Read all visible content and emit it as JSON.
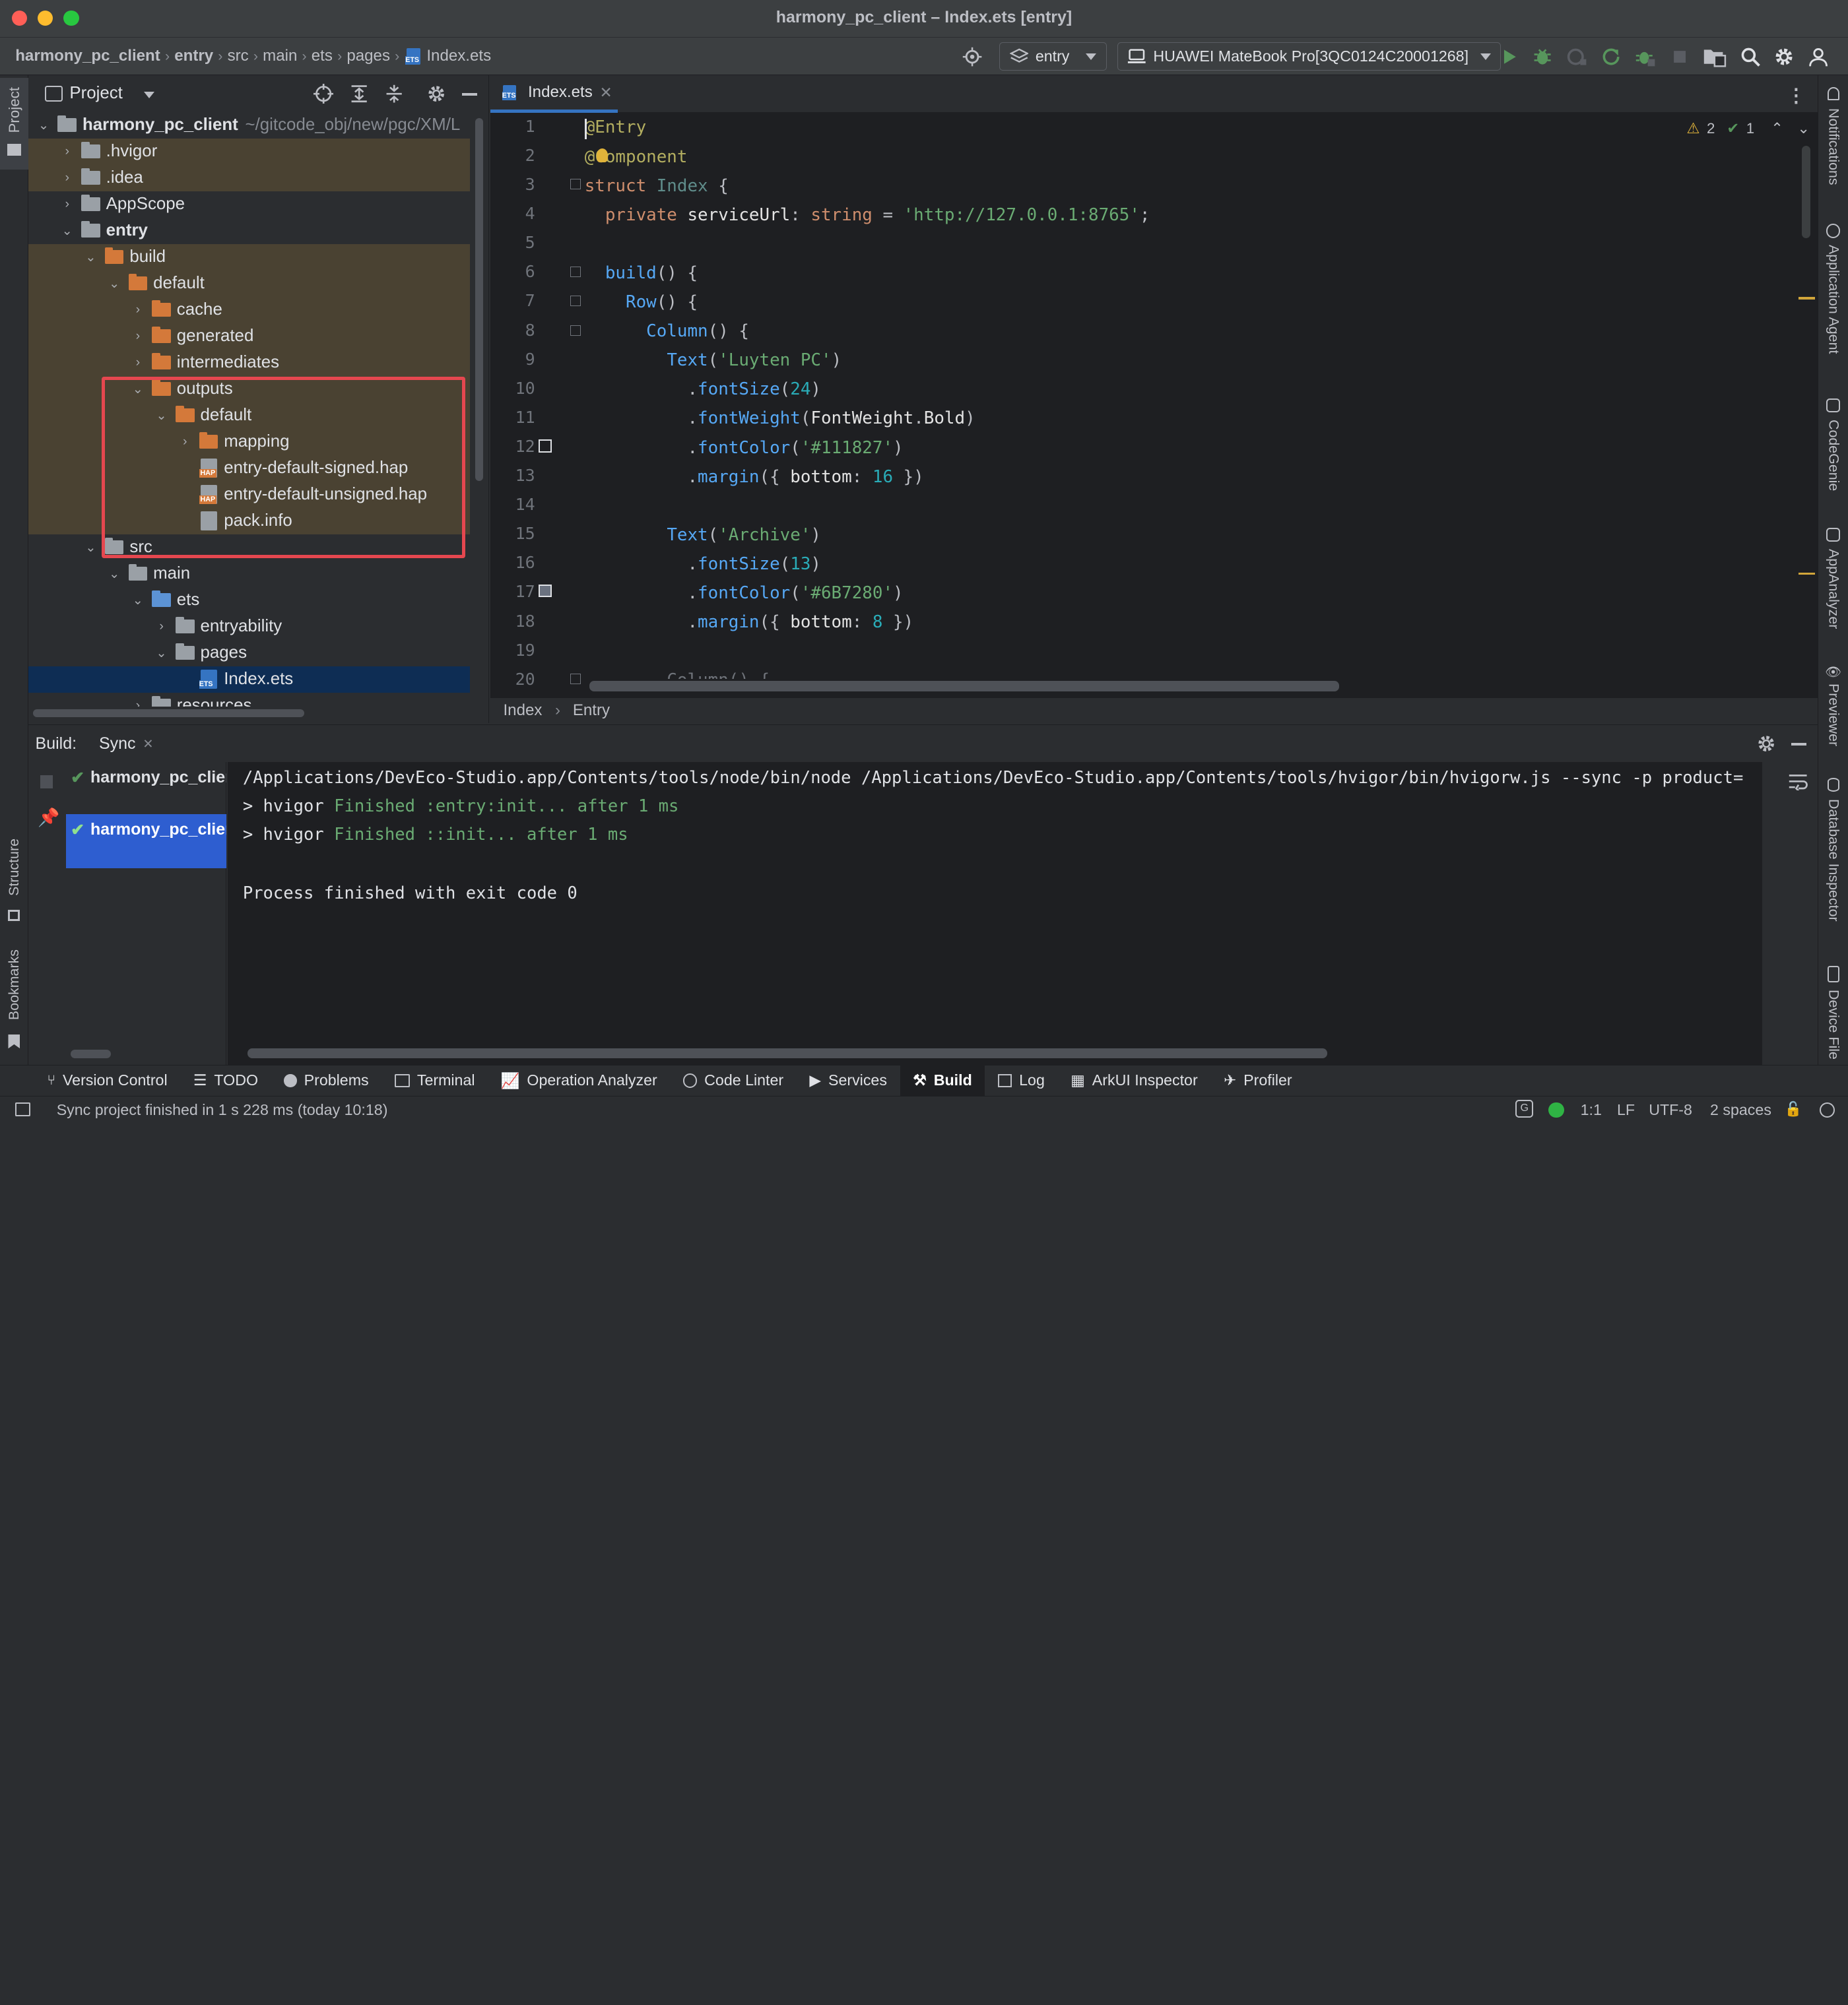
{
  "window": {
    "title": "harmony_pc_client – Index.ets [entry]"
  },
  "breadcrumbs": [
    "harmony_pc_client",
    "entry",
    "src",
    "main",
    "ets",
    "pages",
    "Index.ets"
  ],
  "run_config": {
    "module": "entry",
    "device": "HUAWEI MateBook Pro[3QC0124C20001268]"
  },
  "project_panel": {
    "title": "Project",
    "root_name": "harmony_pc_client",
    "root_path": "~/gitcode_obj/new/pgc/XM/L",
    "tree": [
      {
        "label": "harmony_pc_client"
      },
      {
        "label": ".hvigor"
      },
      {
        "label": ".idea"
      },
      {
        "label": "AppScope"
      },
      {
        "label": "entry"
      },
      {
        "label": "build"
      },
      {
        "label": "default"
      },
      {
        "label": "cache"
      },
      {
        "label": "generated"
      },
      {
        "label": "intermediates"
      },
      {
        "label": "outputs"
      },
      {
        "label": "default"
      },
      {
        "label": "mapping"
      },
      {
        "label": "entry-default-signed.hap"
      },
      {
        "label": "entry-default-unsigned.hap"
      },
      {
        "label": "pack.info"
      },
      {
        "label": "src"
      },
      {
        "label": "main"
      },
      {
        "label": "ets"
      },
      {
        "label": "entryability"
      },
      {
        "label": "pages"
      },
      {
        "label": "Index.ets"
      },
      {
        "label": "resources"
      }
    ]
  },
  "editor": {
    "tab": "Index.ets",
    "inspections": {
      "warnings": "2",
      "ok": "1"
    },
    "breadcrumb": [
      "Index",
      "Entry"
    ],
    "line_numbers": [
      "1",
      "2",
      "3",
      "4",
      "5",
      "6",
      "7",
      "8",
      "9",
      "10",
      "11",
      "12",
      "13",
      "14",
      "15",
      "16",
      "17",
      "18",
      "19",
      "20"
    ]
  },
  "build_panel": {
    "label": "Build:",
    "tab": "Sync",
    "tasks": [
      "harmony_pc_client",
      "harmony_pc_client"
    ],
    "console": {
      "command": "/Applications/DevEco-Studio.app/Contents/tools/node/bin/node /Applications/DevEco-Studio.app/Contents/tools/hvigor/bin/hvigorw.js --sync -p product=",
      "lines": [
        {
          "prefix": "> hvigor ",
          "text": "Finished :entry:init... after 1 ms"
        },
        {
          "prefix": "> hvigor ",
          "text": "Finished ::init... after 1 ms"
        }
      ],
      "exit": "Process finished with exit code 0"
    }
  },
  "tool_windows": [
    "Version Control",
    "TODO",
    "Problems",
    "Terminal",
    "Operation Analyzer",
    "Code Linter",
    "Services",
    "Build",
    "Log",
    "ArkUI Inspector",
    "Profiler"
  ],
  "left_stripe": {
    "top": "Project",
    "structure": "Structure",
    "bookmarks": "Bookmarks"
  },
  "right_stripe": [
    "Notifications",
    "Application Agent",
    "CodeGenie",
    "AppAnalyzer",
    "Previewer",
    "Database Inspector",
    "Device File"
  ],
  "status": {
    "message": "Sync project finished in 1 s 228 ms (today 10:18)",
    "position": "1:1",
    "line_sep": "LF",
    "encoding": "UTF-8",
    "indent": "2 spaces"
  },
  "colors": {
    "accent": "#3574c2",
    "highlight_box": "#e5474f",
    "run_green": "#57965c",
    "folder_orange": "#d4793a"
  }
}
